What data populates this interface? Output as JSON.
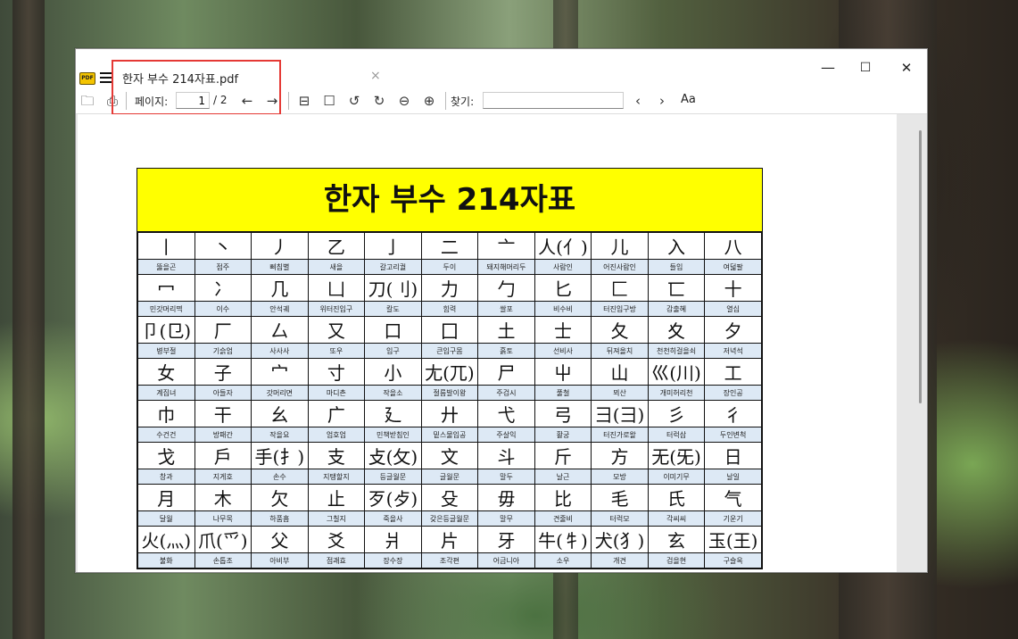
{
  "window": {
    "tab_title": "한자 부수 214자표.pdf",
    "app_badge": "PDF",
    "controls": {
      "minimize": "—",
      "maximize": "☐",
      "close": "✕",
      "tab_close": "×"
    }
  },
  "toolbar": {
    "page_label": "페이지:",
    "current_page": "1",
    "total_pages": "/ 2",
    "find_label": "찾기:",
    "font_toggle": "Aa"
  },
  "document": {
    "title": "한자 부수 214자표",
    "rows": [
      {
        "chars": [
          "丨",
          "丶",
          "丿",
          "乙",
          "亅",
          "二",
          "亠",
          "人(亻)",
          "儿",
          "入",
          "八"
        ],
        "names": [
          "뚫을곤",
          "점주",
          "삐침별",
          "새을",
          "갈고리궐",
          "두이",
          "돼지해머리두",
          "사람인",
          "어진사람인",
          "들입",
          "여덟팔"
        ]
      },
      {
        "chars": [
          "冖",
          "冫",
          "几",
          "凵",
          "刀(刂)",
          "力",
          "勹",
          "匕",
          "匚",
          "匸",
          "十"
        ],
        "names": [
          "민갓머리멱",
          "이수",
          "안석궤",
          "위터진입구",
          "칼도",
          "힘력",
          "쌀포",
          "비수비",
          "터진입구방",
          "감출혜",
          "열십"
        ]
      },
      {
        "chars": [
          "卩(㔾)",
          "厂",
          "厶",
          "又",
          "口",
          "囗",
          "土",
          "士",
          "夂",
          "夊",
          "夕"
        ],
        "names": [
          "병부절",
          "기슭엄",
          "사사사",
          "또우",
          "입구",
          "큰입구몸",
          "흙토",
          "선비사",
          "뒤져올치",
          "천천히걸을쇠",
          "저녁석"
        ]
      },
      {
        "chars": [
          "女",
          "子",
          "宀",
          "寸",
          "小",
          "尢(兀)",
          "尸",
          "屮",
          "山",
          "巛(川)",
          "工"
        ],
        "names": [
          "계집녀",
          "아들자",
          "갓머리면",
          "마디촌",
          "작을소",
          "절름발이왕",
          "주검시",
          "풀철",
          "뫼산",
          "개미허리천",
          "장인공"
        ]
      },
      {
        "chars": [
          "巾",
          "干",
          "幺",
          "广",
          "廴",
          "廾",
          "弋",
          "弓",
          "彐(⺕)",
          "彡",
          "彳"
        ],
        "names": [
          "수건건",
          "방패간",
          "작을요",
          "엄호엄",
          "민책받침인",
          "밑스물입공",
          "주살익",
          "활궁",
          "터진가로왈",
          "터럭삼",
          "두인변척"
        ]
      },
      {
        "chars": [
          "戈",
          "戶",
          "手(扌)",
          "支",
          "攴(攵)",
          "文",
          "斗",
          "斤",
          "方",
          "无(旡)",
          "日"
        ],
        "names": [
          "창과",
          "지게호",
          "손수",
          "지탱할지",
          "등글월문",
          "글월문",
          "말두",
          "날근",
          "모방",
          "이미기무",
          "날일"
        ]
      },
      {
        "chars": [
          "月",
          "木",
          "欠",
          "止",
          "歹(歺)",
          "殳",
          "毋",
          "比",
          "毛",
          "氏",
          "气"
        ],
        "names": [
          "달월",
          "나무목",
          "하품흠",
          "그칠지",
          "죽을사",
          "갖은등글월문",
          "말무",
          "견줄비",
          "터럭모",
          "각씨씨",
          "기운기"
        ]
      },
      {
        "chars": [
          "火(灬)",
          "爪(爫)",
          "父",
          "爻",
          "爿",
          "片",
          "牙",
          "牛(牜)",
          "犬(犭)",
          "玄",
          "玉(王)"
        ],
        "names": [
          "불화",
          "손톱조",
          "아비부",
          "점괘효",
          "장수장",
          "조각편",
          "어금니아",
          "소우",
          "개견",
          "검을현",
          "구슬옥"
        ]
      }
    ]
  }
}
